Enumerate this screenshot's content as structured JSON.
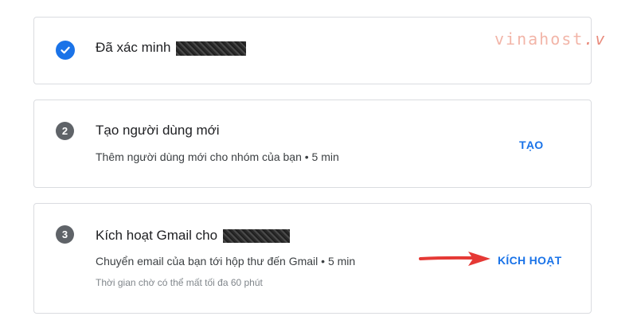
{
  "steps": [
    {
      "status": "done",
      "title": "Đã xác minh",
      "logo_text": "vinahost",
      "logo_suffix": ".v"
    },
    {
      "number": "2",
      "title": "Tạo người dùng mới",
      "description": "Thêm người dùng mới cho nhóm của bạn • 5 min",
      "action_label": "TẠO"
    },
    {
      "number": "3",
      "title": "Kích hoạt Gmail cho",
      "description": "Chuyển email của bạn tới hộp thư đến Gmail • 5 min",
      "note": "Thời gian chờ có thể mất tối đa 60 phút",
      "action_label": "KÍCH HOẠT"
    }
  ],
  "colors": {
    "accent": "#1a73e8",
    "step_badge": "#5f6368",
    "arrow": "#e53935",
    "border": "#dadce0"
  },
  "icons": {
    "done": "check-icon",
    "arrow": "arrow-right-icon"
  }
}
